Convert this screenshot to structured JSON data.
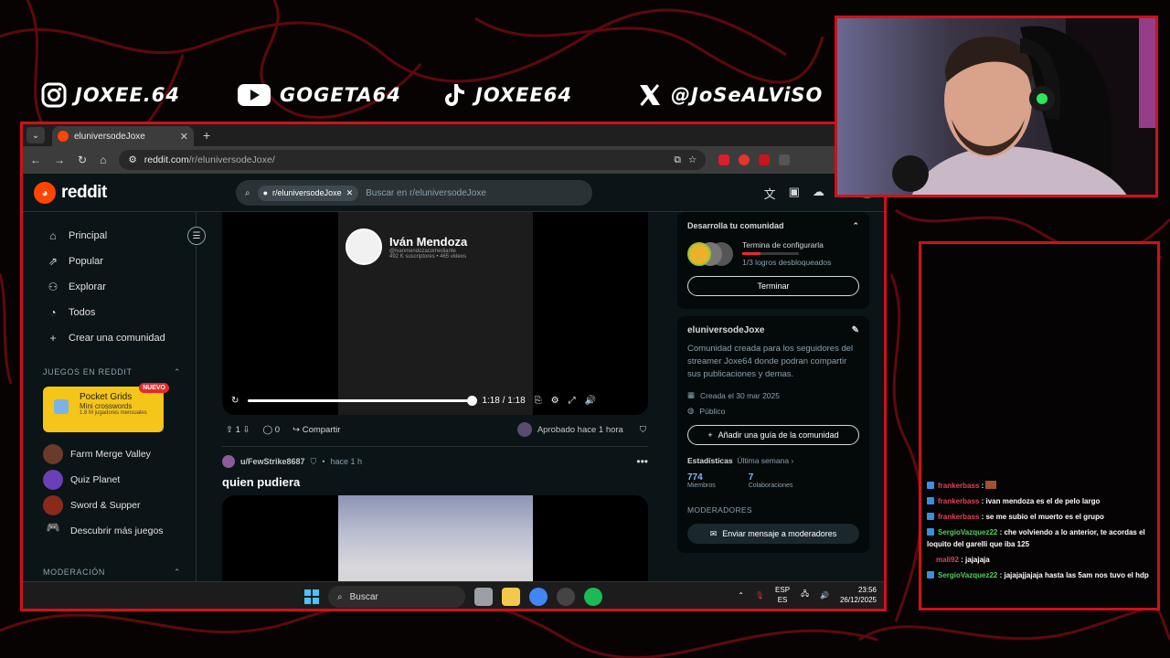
{
  "socials": [
    {
      "icon": "instagram-icon",
      "handle": "JOXEE.64"
    },
    {
      "icon": "youtube-icon",
      "handle": "GOGETA64"
    },
    {
      "icon": "tiktok-icon",
      "handle": "JOXEE64"
    },
    {
      "icon": "x-icon",
      "handle": "@JoSeALViSO"
    }
  ],
  "browser": {
    "tab_title": "eluniversodeJoxe",
    "url_host": "reddit.com",
    "url_path": "/r/eluniversodeJoxe/"
  },
  "reddit": {
    "logo_text": "reddit",
    "search_chip": "r/eluniversodeJoxe",
    "search_placeholder": "Buscar en r/eluniversodeJoxe"
  },
  "nav": {
    "items": [
      {
        "icon": "home-icon",
        "label": "Principal"
      },
      {
        "icon": "popular-icon",
        "label": "Popular"
      },
      {
        "icon": "explore-icon",
        "label": "Explorar"
      },
      {
        "icon": "all-icon",
        "label": "Todos"
      },
      {
        "icon": "plus-icon",
        "label": "Crear una comunidad"
      }
    ],
    "games_title": "JUEGOS EN REDDIT",
    "promo": {
      "title": "Pocket Grids",
      "subtitle": "Mini crosswords",
      "meta": "1.8 M jugadores mensuales",
      "badge": "NUEVO"
    },
    "games": [
      "Farm Merge Valley",
      "Quiz Planet",
      "Sword & Supper",
      "Descubrir más juegos"
    ],
    "mod_title": "MODERACIÓN"
  },
  "post1": {
    "channel_name": "Iván Mendoza",
    "channel_handle": "@ivanmendozacomediante",
    "channel_stats": "492 K suscriptores • 465 videos",
    "time": "1:18 / 1:18",
    "votes": "1",
    "comments": "0",
    "share": "Compartir",
    "approved": "Aprobado hace 1 hora"
  },
  "post2": {
    "user": "u/FewStrike8687",
    "time": "hace 1 h",
    "title": "quien pudiera"
  },
  "sidebar": {
    "grow_title": "Desarrolla tu comunidad",
    "grow_task": "Termina de configurarla",
    "grow_progress_label": "1/3 logros desbloqueados",
    "grow_progress": 0.33,
    "grow_button": "Terminar",
    "community_name": "eluniversodeJoxe",
    "community_desc": "Comunidad creada para los seguidores del streamer Joxe64 donde podran compartir sus publicaciones y demas.",
    "created": "Creada el 30 mar 2025",
    "visibility": "Público",
    "guide_button": "Añadir una guía de la comunidad",
    "stats_title": "Estadísticas",
    "stats_period": "Última semana",
    "members_value": "774",
    "members_label": "Miembros",
    "contrib_value": "7",
    "contrib_label": "Colaboraciones",
    "mods_title": "MODERADORES",
    "mods_button": "Enviar mensaje a moderadores"
  },
  "taskbar": {
    "search": "Buscar",
    "lang1": "ESP",
    "lang2": "ES",
    "time": "23:56",
    "date": "26/12/2025"
  },
  "chat": [
    {
      "user": "frankerbass",
      "color": "#e0435a",
      "text": ""
    },
    {
      "user": "frankerbass",
      "color": "#e0435a",
      "text": "ivan mendoza es el de pelo largo"
    },
    {
      "user": "frankerbass",
      "color": "#e0435a",
      "text": "se me subio el muerto es el grupo"
    },
    {
      "user": "SergioVazquez22",
      "color": "#4fd35a",
      "text": "che volviendo a lo anterior, te acordas el loquito del garelli que iba 125"
    },
    {
      "user": "mali92",
      "color": "#e0435a",
      "text": "jajajaja"
    },
    {
      "user": "SergioVazquez22",
      "color": "#4fd35a",
      "text": "jajajajjajaja hasta las 5am nos tuvo el hdp"
    }
  ]
}
